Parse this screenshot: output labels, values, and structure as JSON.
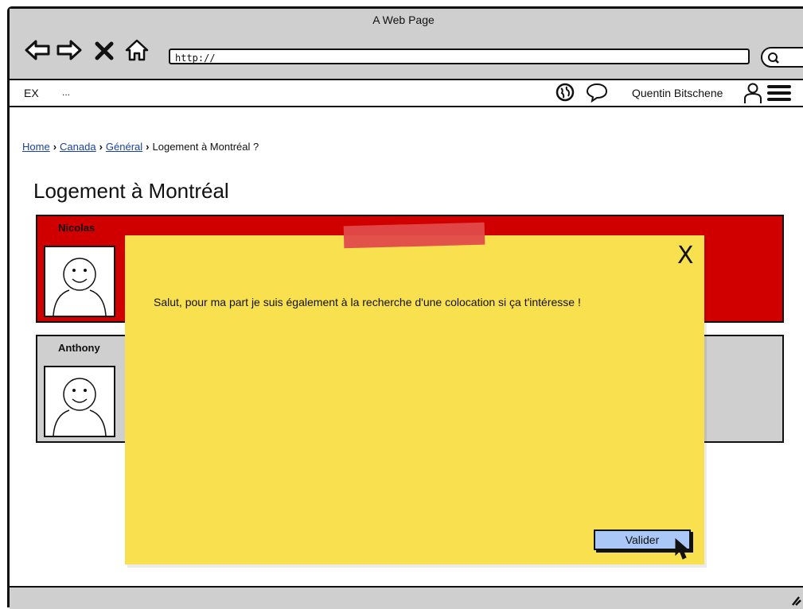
{
  "window": {
    "title": "A Web Page"
  },
  "browser": {
    "url": "http://",
    "nav": [
      "back-arrow-icon",
      "forward-arrow-icon",
      "close-x-icon",
      "home-icon"
    ]
  },
  "menubar": {
    "brand": "EX",
    "brand_suffix": "...",
    "user_name": "Quentin Bitschene",
    "icons": [
      "globe-icon",
      "chat-bubble-icon",
      "user-icon",
      "hamburger-menu-icon"
    ]
  },
  "breadcrumb": {
    "items": [
      {
        "label": "Home",
        "link": true
      },
      {
        "label": "Canada",
        "link": true
      },
      {
        "label": "Général",
        "link": true
      },
      {
        "label": "Logement à Montréal ?",
        "link": false
      }
    ]
  },
  "page": {
    "title": "Logement à Montréal"
  },
  "posts": [
    {
      "author": "Nicolas",
      "color": "#d10000"
    },
    {
      "author": "Anthony",
      "color": "#cfcfcf"
    }
  ],
  "modal": {
    "close_label": "X",
    "message": "Salut, pour ma part je suis également à la recherche d'une colocation si ça t'intéresse !",
    "validate_label": "Valider",
    "color": "#f8e04e"
  }
}
